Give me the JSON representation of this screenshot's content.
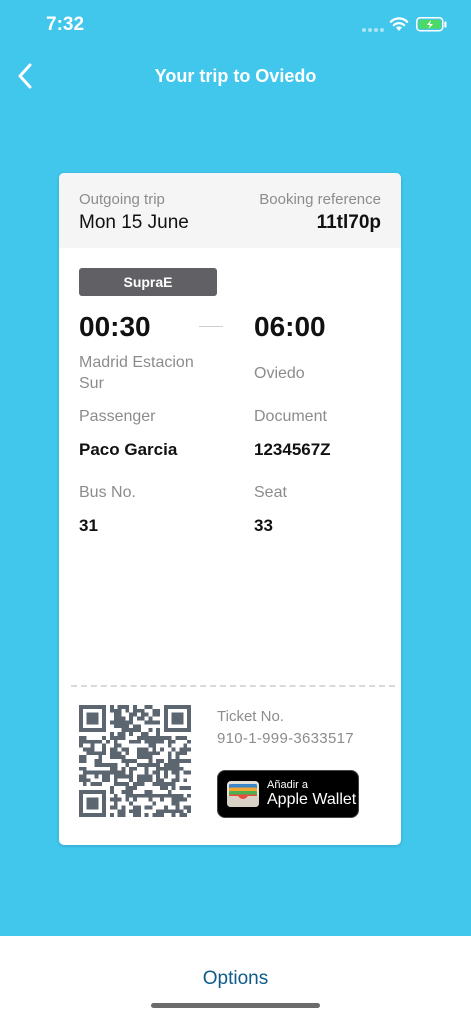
{
  "status": {
    "time": "7:32"
  },
  "nav": {
    "title": "Your trip to Oviedo",
    "back_icon": "chevron-left-icon"
  },
  "colors": {
    "background": "#41c6ec",
    "card": "#ffffff",
    "badge": "#606065",
    "options": "#0e5a8a",
    "battery": "#4cd964"
  },
  "ticket": {
    "trip_label": "Outgoing trip",
    "date": "Mon 15 June",
    "reference_label": "Booking reference",
    "reference": "11tl70p",
    "operator": "SupraE",
    "departure_time": "00:30",
    "arrival_time": "06:00",
    "origin": "Madrid Estacion Sur",
    "destination": "Oviedo",
    "passenger_label": "Passenger",
    "passenger": "Paco Garcia",
    "document_label": "Document",
    "document": "1234567Z",
    "bus_label": "Bus No.",
    "bus": "31",
    "seat_label": "Seat",
    "seat": "33",
    "ticket_no_label": "Ticket No.",
    "ticket_no": "910-1-999-3633517"
  },
  "wallet": {
    "line1": "Añadir a",
    "line2": "Apple Wallet",
    "icon": "wallet-icon"
  },
  "footer": {
    "options_label": "Options"
  }
}
